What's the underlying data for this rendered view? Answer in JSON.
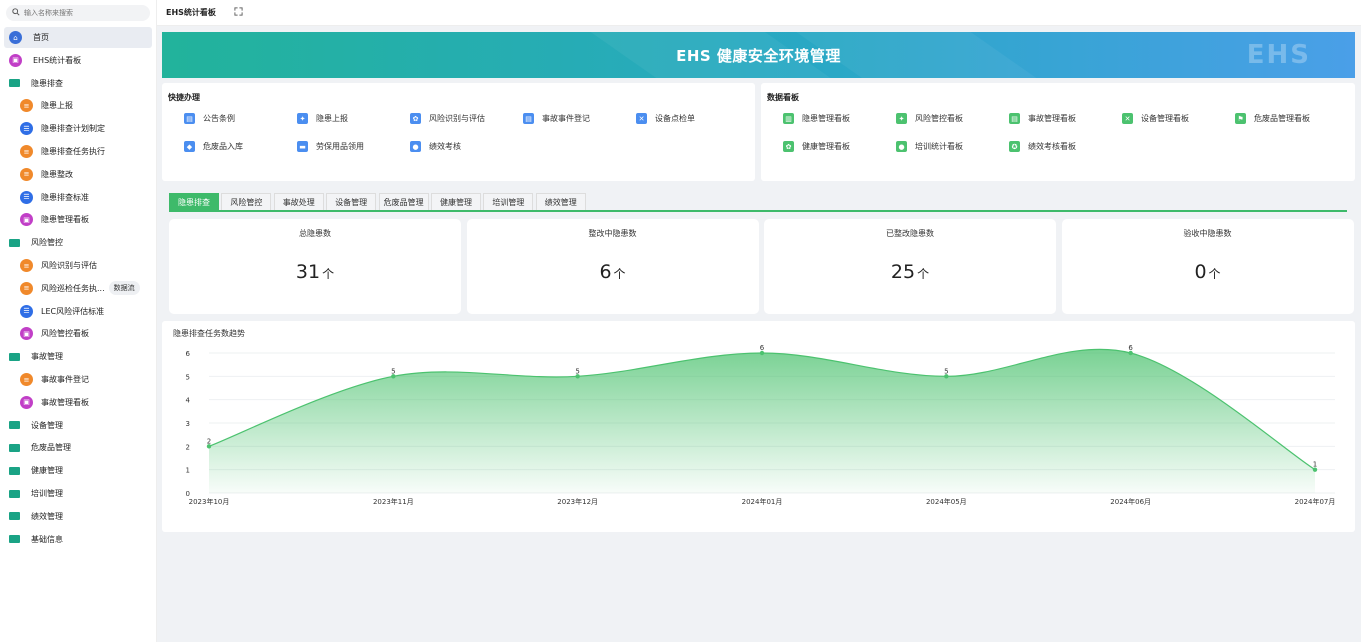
{
  "sidebar": {
    "search_placeholder": "输入名称来搜索",
    "items": [
      {
        "label": "首页",
        "level": 1,
        "icon": "home-icon",
        "color": "#3a6fd8",
        "active": true
      },
      {
        "label": "EHS统计看板",
        "level": 1,
        "icon": "dashboard-icon",
        "color": "#c13fc7"
      },
      {
        "label": "隐患排查",
        "level": 1,
        "icon": "folder-icon"
      },
      {
        "label": "隐患上报",
        "level": 2,
        "icon": "form-icon",
        "color": "#f0892b"
      },
      {
        "label": "隐患排查计划制定",
        "level": 2,
        "icon": "list-icon",
        "color": "#2f6ee6"
      },
      {
        "label": "隐患排查任务执行",
        "level": 2,
        "icon": "form-icon",
        "color": "#f0892b"
      },
      {
        "label": "隐患整改",
        "level": 2,
        "icon": "form-icon",
        "color": "#f0892b"
      },
      {
        "label": "隐患排查标准",
        "level": 2,
        "icon": "list-icon",
        "color": "#2f6ee6"
      },
      {
        "label": "隐患管理看板",
        "level": 2,
        "icon": "dashboard-icon",
        "color": "#c13fc7"
      },
      {
        "label": "风险管控",
        "level": 1,
        "icon": "folder-icon"
      },
      {
        "label": "风险识别与评估",
        "level": 2,
        "icon": "form-icon",
        "color": "#f0892b"
      },
      {
        "label": "风险巡检任务执...",
        "level": 2,
        "icon": "form-icon",
        "color": "#f0892b",
        "tag": "数据流"
      },
      {
        "label": "LEC风险评估标准",
        "level": 2,
        "icon": "list-icon",
        "color": "#2f6ee6"
      },
      {
        "label": "风险管控看板",
        "level": 2,
        "icon": "dashboard-icon",
        "color": "#c13fc7"
      },
      {
        "label": "事故管理",
        "level": 1,
        "icon": "folder-icon"
      },
      {
        "label": "事故事件登记",
        "level": 2,
        "icon": "form-icon",
        "color": "#f0892b"
      },
      {
        "label": "事故管理看板",
        "level": 2,
        "icon": "dashboard-icon",
        "color": "#c13fc7"
      },
      {
        "label": "设备管理",
        "level": 1,
        "icon": "folder-icon"
      },
      {
        "label": "危废品管理",
        "level": 1,
        "icon": "folder-icon"
      },
      {
        "label": "健康管理",
        "level": 1,
        "icon": "folder-icon"
      },
      {
        "label": "培训管理",
        "level": 1,
        "icon": "folder-icon"
      },
      {
        "label": "绩效管理",
        "level": 1,
        "icon": "folder-icon"
      },
      {
        "label": "基础信息",
        "level": 1,
        "icon": "folder-icon"
      }
    ]
  },
  "header": {
    "title": "EHS统计看板",
    "fullscreen_icon": "fullscreen-icon"
  },
  "banner": {
    "title": "EHS 健康安全环境管理",
    "watermark": "EHS"
  },
  "quick": {
    "title": "快捷办理",
    "items": [
      {
        "label": "公告条例",
        "icon": "clipboard-icon",
        "color": "#4b8ef0"
      },
      {
        "label": "隐患上报",
        "icon": "hammer-icon",
        "color": "#4b8ef0"
      },
      {
        "label": "风险识别与评估",
        "icon": "gear-icon",
        "color": "#4b8ef0"
      },
      {
        "label": "事故事件登记",
        "icon": "clipboard-icon",
        "color": "#4b8ef0"
      },
      {
        "label": "设备点检单",
        "icon": "tools-icon",
        "color": "#4b8ef0"
      },
      {
        "label": "危废品入库",
        "icon": "shield-icon",
        "color": "#4b8ef0"
      },
      {
        "label": "劳保用品领用",
        "icon": "truck-icon",
        "color": "#4b8ef0"
      },
      {
        "label": "绩效考核",
        "icon": "user-icon",
        "color": "#4b8ef0"
      }
    ]
  },
  "boards": {
    "title": "数据看板",
    "items": [
      {
        "label": "隐患管理看板",
        "icon": "bar-chart-icon",
        "color": "#4cc26f"
      },
      {
        "label": "风险管控看板",
        "icon": "hammer-icon",
        "color": "#4cc26f"
      },
      {
        "label": "事故管理看板",
        "icon": "clipboard-icon",
        "color": "#4cc26f"
      },
      {
        "label": "设备管理看板",
        "icon": "tools-icon",
        "color": "#4cc26f"
      },
      {
        "label": "危废品管理看板",
        "icon": "flag-icon",
        "color": "#4cc26f"
      },
      {
        "label": "健康管理看板",
        "icon": "gear-icon",
        "color": "#4cc26f"
      },
      {
        "label": "培训统计看板",
        "icon": "user-icon",
        "color": "#4cc26f"
      },
      {
        "label": "绩效考核看板",
        "icon": "medal-icon",
        "color": "#4cc26f"
      }
    ]
  },
  "tabs": [
    {
      "label": "隐患排查",
      "active": true
    },
    {
      "label": "风险管控"
    },
    {
      "label": "事故处理"
    },
    {
      "label": "设备管理"
    },
    {
      "label": "危废品管理"
    },
    {
      "label": "健康管理"
    },
    {
      "label": "培训管理"
    },
    {
      "label": "绩效管理"
    }
  ],
  "stats": [
    {
      "label": "总隐患数",
      "value": "31",
      "unit": "个"
    },
    {
      "label": "整改中隐患数",
      "value": "6",
      "unit": "个"
    },
    {
      "label": "已整改隐患数",
      "value": "25",
      "unit": "个"
    },
    {
      "label": "验收中隐患数",
      "value": "0",
      "unit": "个"
    }
  ],
  "chart_data": {
    "type": "area",
    "title": "隐患排查任务数趋势",
    "categories": [
      "2023年10月",
      "2023年11月",
      "2023年12月",
      "2024年01月",
      "2024年05月",
      "2024年06月",
      "2024年07月"
    ],
    "series": [
      {
        "values": [
          2,
          5,
          5,
          6,
          5,
          6,
          1
        ]
      }
    ],
    "ylim": [
      0,
      6
    ],
    "yticks": [
      0,
      1,
      2,
      3,
      4,
      5,
      6
    ],
    "color": "#4cc26f",
    "grid": true
  }
}
